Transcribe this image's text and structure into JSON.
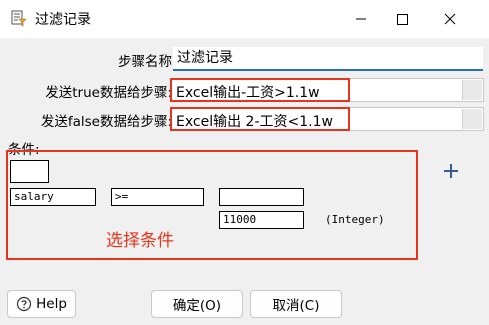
{
  "window": {
    "title": "过滤记录"
  },
  "form": {
    "step_name_label": "步骤名称",
    "step_name_value": "过滤记录",
    "true_label": "发送true数据给步骤:",
    "true_value": "Excel输出-工资>1.1w",
    "false_label": "发送false数据给步骤:",
    "false_value": "Excel输出 2-工资<1.1w"
  },
  "condition": {
    "label": "条件:",
    "left_field": "salary",
    "operator": ">=",
    "right_field": "",
    "value": "11000",
    "value_type": "(Integer)",
    "annotation": "选择条件"
  },
  "buttons": {
    "help": "Help",
    "ok": "确定(O)",
    "cancel": "取消(C)"
  },
  "colors": {
    "highlight": "#e8341c",
    "accent": "#2b6fb2",
    "plus": "#3b5b8c"
  }
}
